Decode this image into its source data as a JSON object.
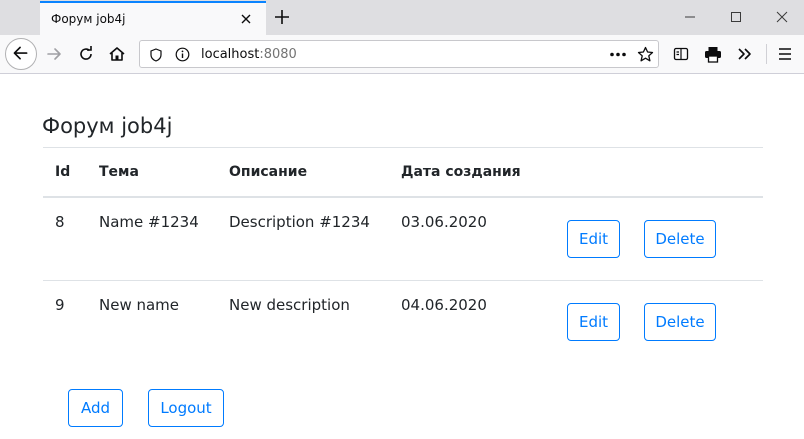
{
  "browser": {
    "tab_title": "Форум job4j",
    "url_host": "localhost",
    "url_port": ":8080"
  },
  "page": {
    "title": "Форум job4j",
    "table": {
      "headers": [
        "Id",
        "Тема",
        "Описание",
        "Дата создания"
      ],
      "rows": [
        {
          "id": "8",
          "topic": "Name #1234",
          "description": "Description #1234",
          "created": "03.06.2020",
          "edit_label": "Edit",
          "delete_label": "Delete"
        },
        {
          "id": "9",
          "topic": "New name",
          "description": "New description",
          "created": "04.06.2020",
          "edit_label": "Edit",
          "delete_label": "Delete"
        }
      ]
    },
    "add_label": "Add",
    "logout_label": "Logout"
  },
  "colors": {
    "primary": "#007bff",
    "tab_accent": "#0a84ff",
    "text": "#212529",
    "border": "#dee2e6"
  }
}
